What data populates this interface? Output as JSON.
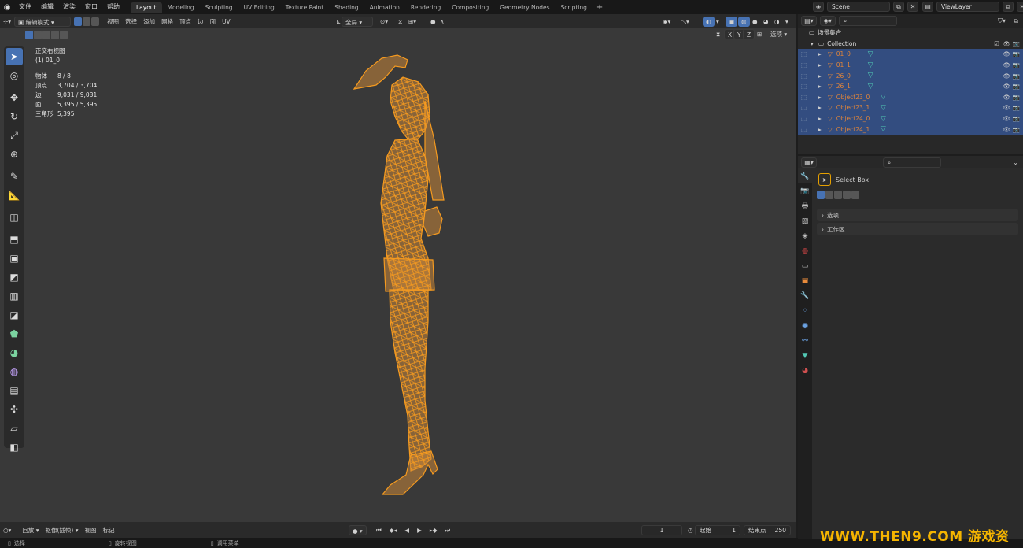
{
  "topbar": {
    "menus": [
      "文件",
      "编辑",
      "渲染",
      "窗口",
      "帮助"
    ],
    "workspaces": [
      "Layout",
      "Modeling",
      "Sculpting",
      "UV Editing",
      "Texture Paint",
      "Shading",
      "Animation",
      "Rendering",
      "Compositing",
      "Geometry Nodes",
      "Scripting"
    ],
    "active_workspace": "Layout",
    "add_workspace": "+",
    "scene": "Scene",
    "view_layer": "ViewLayer"
  },
  "viewport_header": {
    "mode": "编辑模式",
    "menus": [
      "视图",
      "选择",
      "添加",
      "网格",
      "顶点",
      "边",
      "面",
      "UV"
    ],
    "transform_orientation": "全局",
    "axes": [
      "X",
      "Y",
      "Z"
    ],
    "options": "选项"
  },
  "overlay": {
    "view_name": "正交右视图",
    "object_name": "(1) 01_0",
    "stats": [
      {
        "label": "物体",
        "value": "8 / 8"
      },
      {
        "label": "顶点",
        "value": "3,704 / 3,704"
      },
      {
        "label": "边",
        "value": "9,031 / 9,031"
      },
      {
        "label": "面",
        "value": "5,395 / 5,395"
      },
      {
        "label": "三角形",
        "value": "5,395"
      }
    ]
  },
  "tools": [
    {
      "icon": "select-box-icon",
      "glyph": "➤"
    },
    {
      "icon": "cursor-icon",
      "glyph": "◎"
    },
    {
      "icon": "move-icon",
      "glyph": "✥"
    },
    {
      "icon": "rotate-icon",
      "glyph": "↻"
    },
    {
      "icon": "scale-icon",
      "glyph": "⤢"
    },
    {
      "icon": "transform-icon",
      "glyph": "⊕"
    },
    {
      "icon": "annotate-icon",
      "glyph": "✎"
    },
    {
      "icon": "measure-icon",
      "glyph": "📐"
    },
    {
      "icon": "add-cube-icon",
      "glyph": "◫"
    },
    {
      "icon": "extrude-icon",
      "glyph": "⬒"
    },
    {
      "icon": "inset-icon",
      "glyph": "▣"
    },
    {
      "icon": "bevel-icon",
      "glyph": "◩"
    },
    {
      "icon": "loop-cut-icon",
      "glyph": "▥"
    },
    {
      "icon": "knife-icon",
      "glyph": "◪"
    },
    {
      "icon": "poly-build-icon",
      "glyph": "⬟"
    },
    {
      "icon": "spin-icon",
      "glyph": "◕"
    },
    {
      "icon": "smooth-icon",
      "glyph": "◍"
    },
    {
      "icon": "edge-slide-icon",
      "glyph": "▤"
    },
    {
      "icon": "shrink-fatten-icon",
      "glyph": "✣"
    },
    {
      "icon": "shear-icon",
      "glyph": "▱"
    },
    {
      "icon": "rip-icon",
      "glyph": "◧"
    }
  ],
  "timeline": {
    "playback": "回放",
    "keying": "抠像(插帧)",
    "view": "视图",
    "marker": "标记",
    "current_frame": "1",
    "start_label": "起始",
    "start": "1",
    "end_label": "结束点",
    "end": "250"
  },
  "statusbar": {
    "items": [
      "选择",
      "旋转视图",
      "调用菜单"
    ]
  },
  "outliner": {
    "scene_collection": "场景集合",
    "collection": "Collection",
    "objects": [
      "01_0",
      "01_1",
      "26_0",
      "26_1",
      "Object23_0",
      "Object23_1",
      "Object24_0",
      "Object24_1"
    ]
  },
  "properties": {
    "tool_name": "Select Box",
    "sections": [
      "选项",
      "工作区"
    ]
  },
  "watermark": {
    "text": "WWW.THEN9.COM 游戏资源"
  },
  "colors": {
    "accent": "#4772b3",
    "mesh_orange": "#f59a1f",
    "selected_row": "#334d80"
  }
}
